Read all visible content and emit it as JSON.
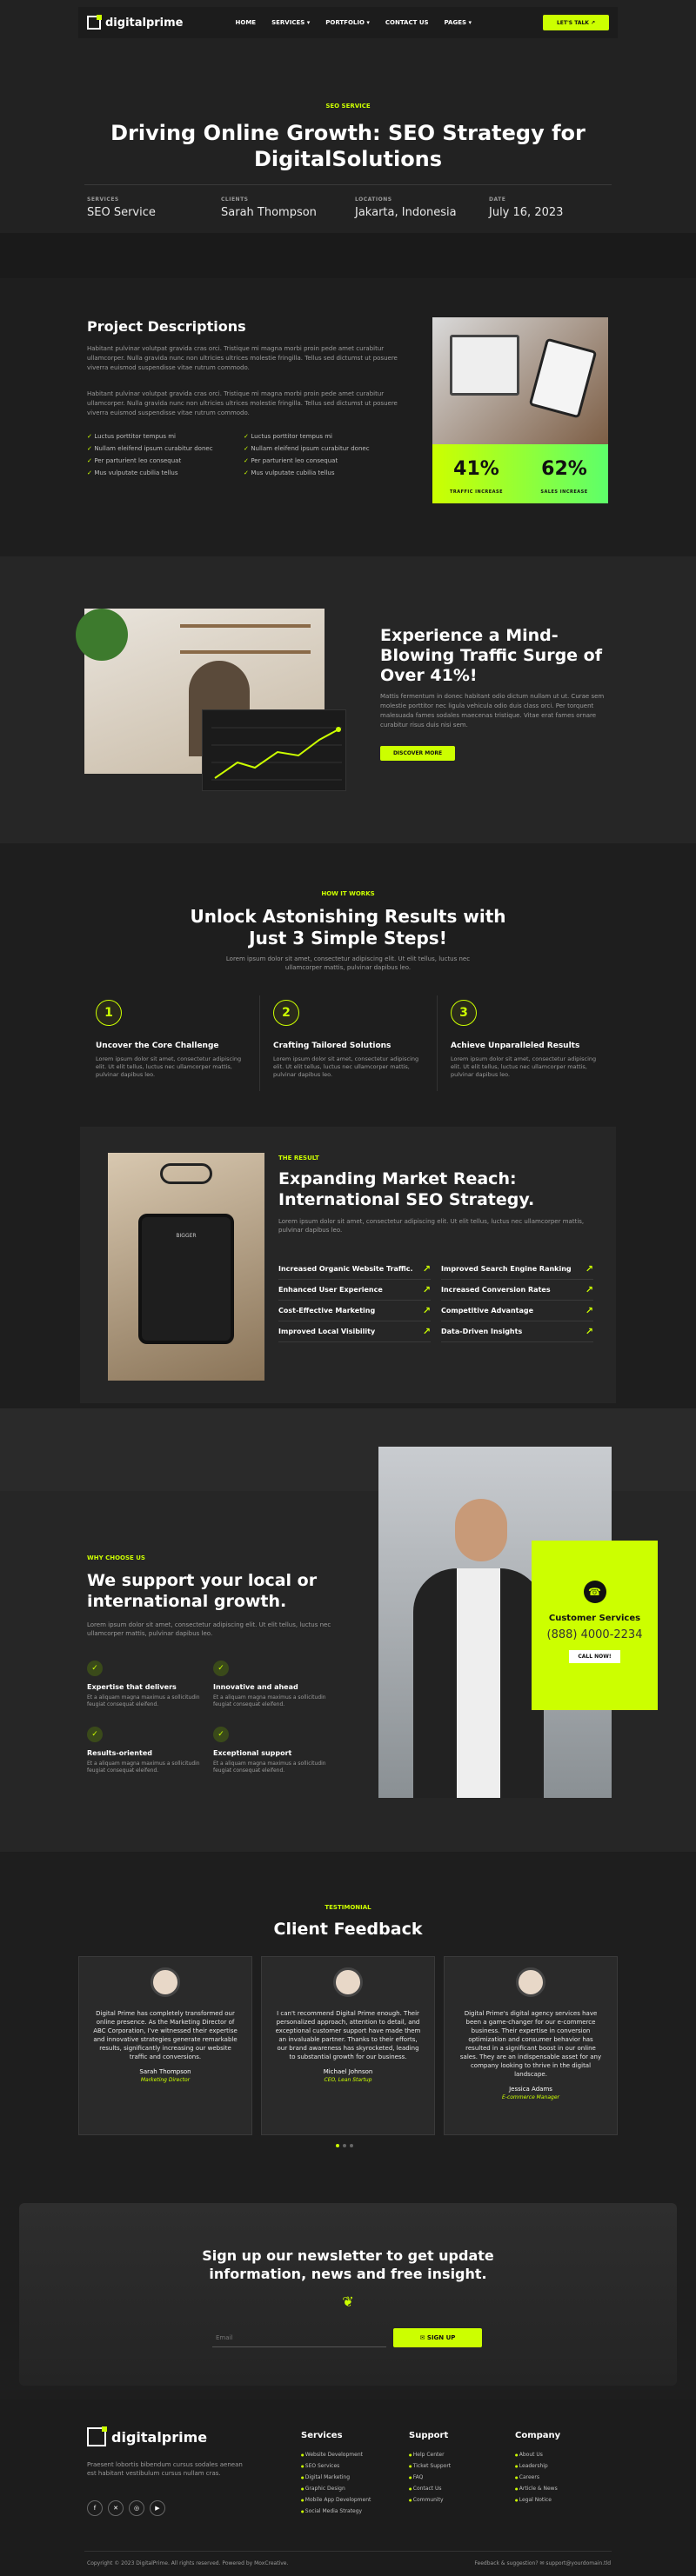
{
  "nav": {
    "brand": "digitalprime",
    "menu": [
      "HOME",
      "SERVICES ▾",
      "PORTFOLIO ▾",
      "CONTACT US",
      "PAGES ▾"
    ],
    "cta": "LET'S TALK ↗"
  },
  "hero": {
    "tag": "SEO SERVICE",
    "title": "Driving Online Growth: SEO Strategy for DigitalSolutions",
    "meta": [
      {
        "k": "SERVICES",
        "v": "SEO Service"
      },
      {
        "k": "CLIENTS",
        "v": "Sarah Thompson"
      },
      {
        "k": "LOCATIONS",
        "v": "Jakarta, Indonesia"
      },
      {
        "k": "DATE",
        "v": "July 16, 2023"
      }
    ]
  },
  "project": {
    "title": "Project Descriptions",
    "p1": "Habitant pulvinar volutpat gravida cras orci. Tristique mi magna morbi proin pede amet curabitur ullamcorper. Nulla gravida nunc non ultricies ultrices molestie fringilla. Tellus sed dictumst ut posuere viverra euismod suspendisse vitae rutrum commodo.",
    "p2": "Habitant pulvinar volutpat gravida cras orci. Tristique mi magna morbi proin pede amet curabitur ullamcorper. Nulla gravida nunc non ultricies ultrices molestie fringilla. Tellus sed dictumst ut posuere viverra euismod suspendisse vitae rutrum commodo.",
    "checks": [
      "Luctus porttitor tempus mi",
      "Luctus porttitor tempus mi",
      "Nullam eleifend ipsum curabitur donec",
      "Nullam eleifend ipsum curabitur donec",
      "Per parturient leo consequat",
      "Per parturient leo consequat",
      "Mus vulputate cubilia tellus",
      "Mus vulputate cubilia tellus"
    ],
    "stats": [
      {
        "v": "41%",
        "k": "TRAFFIC INCREASE"
      },
      {
        "v": "62%",
        "k": "SALES INCREASE"
      }
    ]
  },
  "experience": {
    "title": "Experience a Mind-Blowing Traffic Surge of Over 41%!",
    "text": "Mattis fermentum in donec habitant odio dictum nullam ut ut. Curae sem molestie porttitor nec ligula vehicula odio duis class orci. Per torquent malesuada fames sodales maecenas tristique. Vitae erat fames ornare curabitur risus duis nisi sem.",
    "cta": "DISCOVER MORE"
  },
  "how": {
    "tag": "HOW IT WORKS",
    "title": "Unlock Astonishing Results with Just 3 Simple Steps!",
    "sub": "Lorem ipsum dolor sit amet, consectetur adipiscing elit. Ut elit tellus, luctus nec ullamcorper mattis, pulvinar dapibus leo.",
    "steps": [
      {
        "n": "1",
        "t": "Uncover the Core Challenge",
        "d": "Lorem ipsum dolor sit amet, consectetur adipiscing elit. Ut elit tellus, luctus nec ullamcorper mattis, pulvinar dapibus leo."
      },
      {
        "n": "2",
        "t": "Crafting Tailored Solutions",
        "d": "Lorem ipsum dolor sit amet, consectetur adipiscing elit. Ut elit tellus, luctus nec ullamcorper mattis, pulvinar dapibus leo."
      },
      {
        "n": "3",
        "t": "Achieve Unparalleled Results",
        "d": "Lorem ipsum dolor sit amet, consectetur adipiscing elit. Ut elit tellus, luctus nec ullamcorper mattis, pulvinar dapibus leo."
      }
    ]
  },
  "result": {
    "tag": "THE RESULT",
    "title": "Expanding Market Reach: International SEO Strategy.",
    "sub": "Lorem ipsum dolor sit amet, consectetur adipiscing elit. Ut elit tellus, luctus nec ullamcorper mattis, pulvinar dapibus leo.",
    "items": [
      "Increased Organic Website Traffic.",
      "Improved Search Engine Ranking",
      "Enhanced User Experience",
      "Increased Conversion Rates",
      "Cost-Effective Marketing",
      "Competitive Advantage",
      "Improved Local Visibility",
      "Data-Driven Insights"
    ]
  },
  "why": {
    "tag": "WHY CHOOSE US",
    "title": "We support your local or international growth.",
    "sub": "Lorem ipsum dolor sit amet, consectetur adipiscing elit. Ut elit tellus, luctus nec ullamcorper mattis, pulvinar dapibus leo.",
    "features": [
      {
        "t": "Expertise that delivers",
        "d": "Et a aliquam magna maximus a sollicitudin feugiat consequat eleifend."
      },
      {
        "t": "Innovative and ahead",
        "d": "Et a aliquam magna maximus a sollicitudin feugiat consequat eleifend."
      },
      {
        "t": "Results-oriented",
        "d": "Et a aliquam magna maximus a sollicitudin feugiat consequat eleifend."
      },
      {
        "t": "Exceptional support",
        "d": "Et a aliquam magna maximus a sollicitudin feugiat consequat eleifend."
      }
    ],
    "card": {
      "title": "Customer Services",
      "phone": "(888) 4000-2234",
      "cta": "CALL NOW!"
    }
  },
  "testimonial": {
    "tag": "TESTIMONIAL",
    "title": "Client Feedback",
    "cards": [
      {
        "text": "Digital Prime has completely transformed our online presence. As the Marketing Director of ABC Corporation, I've witnessed their expertise and innovative strategies generate remarkable results, significantly increasing our website traffic and conversions.",
        "name": "Sarah Thompson",
        "role": "Marketing Director"
      },
      {
        "text": "I can't recommend Digital Prime enough. Their personalized approach, attention to detail, and exceptional customer support have made them an invaluable partner. Thanks to their efforts, our brand awareness has skyrocketed, leading to substantial growth for our business.",
        "name": "Michael Johnson",
        "role": "CEO, Lean Startup"
      },
      {
        "text": "Digital Prime's digital agency services have been a game-changer for our e-commerce business. Their expertise in conversion optimization and consumer behavior has resulted in a significant boost in our online sales. They are an indispensable asset for any company looking to thrive in the digital landscape.",
        "name": "Jessica Adams",
        "role": "E-commerce Manager"
      }
    ]
  },
  "newsletter": {
    "title": "Sign up our newsletter to get update information, news and free insight.",
    "placeholder": "Email",
    "cta": "✉ SIGN UP"
  },
  "footer": {
    "brand": "digitalprime",
    "desc": "Praesent lobortis bibendum cursus sodales aenean est habitant vestibulum cursus nullam cras.",
    "social": [
      "f",
      "✕",
      "◎",
      "▶"
    ],
    "cols": [
      {
        "t": "Services",
        "items": [
          "Website Development",
          "SEO Services",
          "Digital Marketing",
          "Graphic Design",
          "Mobile App Development",
          "Social Media Strategy"
        ]
      },
      {
        "t": "Support",
        "items": [
          "Help Center",
          "Ticket Support",
          "FAQ",
          "Contact Us",
          "Community"
        ]
      },
      {
        "t": "Company",
        "items": [
          "About Us",
          "Leadership",
          "Careers",
          "Article & News",
          "Legal Notice"
        ]
      }
    ],
    "copyright": "Copyright © 2023 DigitalPrime. All rights reserved. Powered by MoxCreative.",
    "right": "Feedback & suggestion?   ✉ support@yourdomain.tld"
  }
}
